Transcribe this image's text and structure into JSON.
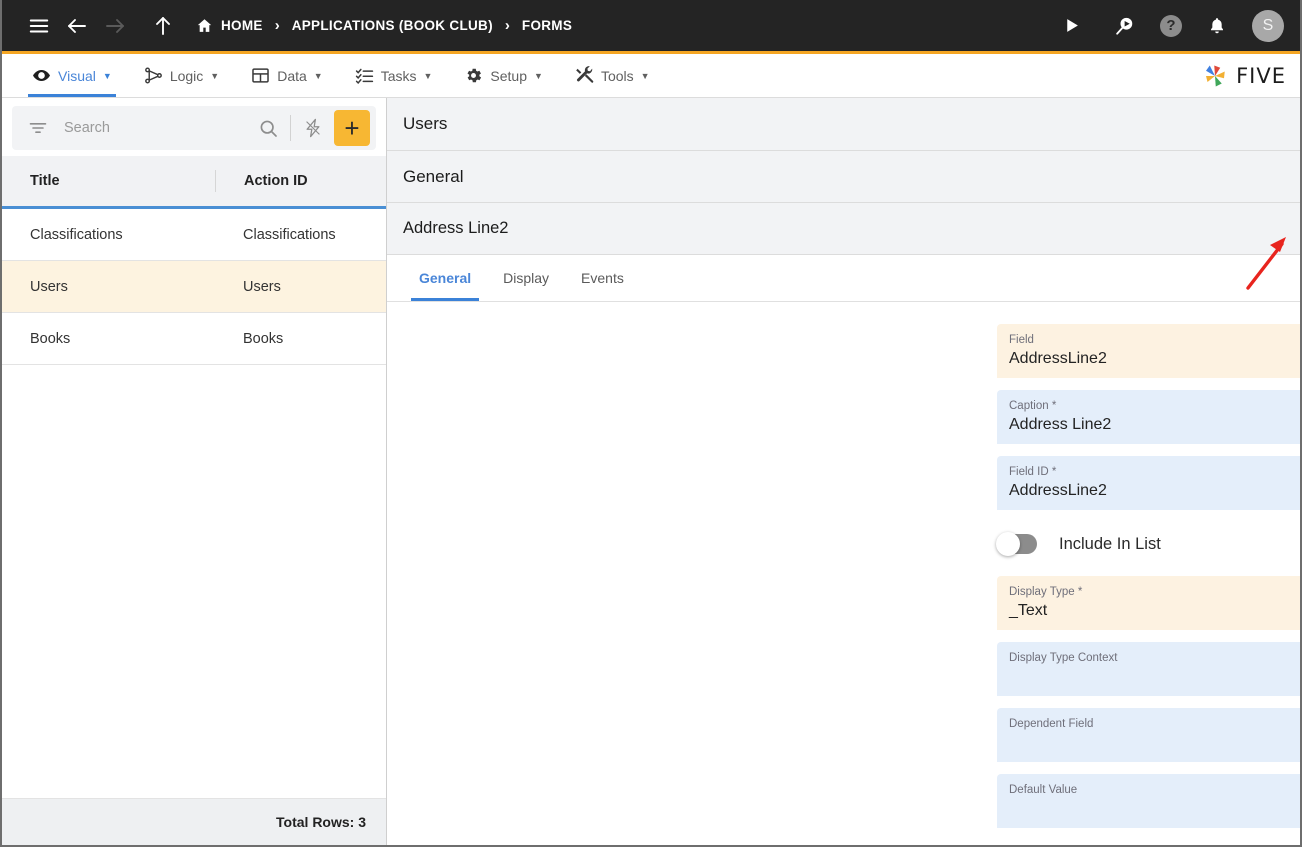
{
  "topbar": {
    "icons": {
      "menu": "hamburger-menu-icon",
      "back": "back-arrow-icon",
      "forward": "forward-arrow-icon",
      "up": "up-arrow-icon"
    },
    "breadcrumbs": [
      {
        "label": "HOME",
        "icon": "home-icon"
      },
      {
        "label": "APPLICATIONS (BOOK CLUB)",
        "icon": ""
      },
      {
        "label": "FORMS",
        "icon": ""
      }
    ],
    "separator": "›",
    "actions": [
      {
        "name": "run-icon",
        "glyph": "▶"
      },
      {
        "name": "search-run-icon",
        "glyph": ""
      },
      {
        "name": "help-icon",
        "glyph": "?"
      },
      {
        "name": "notifications-bell-icon",
        "glyph": ""
      }
    ],
    "avatar_initial": "S",
    "accent_color": "#f5a623"
  },
  "menubar": {
    "items": [
      {
        "label": "Visual",
        "icon": "eye-icon",
        "active": true
      },
      {
        "label": "Logic",
        "icon": "logic-nodes-icon",
        "active": false
      },
      {
        "label": "Data",
        "icon": "table-grid-icon",
        "active": false
      },
      {
        "label": "Tasks",
        "icon": "checklist-icon",
        "active": false
      },
      {
        "label": "Setup",
        "icon": "gear-icon",
        "active": false
      },
      {
        "label": "Tools",
        "icon": "tools-icon",
        "active": false
      }
    ],
    "caret": "▼",
    "brand": "FIVE",
    "active_color": "#4a86d8"
  },
  "left_panel": {
    "search": {
      "placeholder": "Search",
      "value": ""
    },
    "buttons": {
      "filter": "filter-icon",
      "search": "search-icon",
      "lightning": "lightning-bolt-icon",
      "add": "+"
    },
    "table": {
      "columns": [
        "Title",
        "Action ID"
      ],
      "rows": [
        {
          "title": "Classifications",
          "action_id": "Classifications",
          "selected": false
        },
        {
          "title": "Users",
          "action_id": "Users",
          "selected": true
        },
        {
          "title": "Books",
          "action_id": "Books",
          "selected": false
        }
      ]
    },
    "footer": "Total Rows: 3",
    "selected_row_color": "#fdf3e0"
  },
  "right_panel": {
    "header_form": {
      "title": "Users",
      "close": "close-icon",
      "confirm": "check-icon"
    },
    "header_section": {
      "title": "General",
      "back": "back-arrow-icon"
    },
    "header_field": {
      "title": "Address Line2",
      "close": "close-icon",
      "confirm": "check-icon"
    },
    "tabs": [
      {
        "label": "General",
        "active": true
      },
      {
        "label": "Display",
        "active": false
      },
      {
        "label": "Events",
        "active": false
      }
    ],
    "fields": [
      {
        "label": "Field",
        "value": "AddressLine2",
        "style": "yellow",
        "dropdown": true,
        "code": false,
        "help": "help-icon"
      },
      {
        "label": "Caption *",
        "value": "Address Line2",
        "style": "blue",
        "dropdown": false,
        "code": false,
        "help": "help-icon"
      },
      {
        "label": "Field ID *",
        "value": "AddressLine2",
        "style": "blue",
        "dropdown": false,
        "code": false,
        "help": "help-icon"
      }
    ],
    "toggle": {
      "label": "Include In List",
      "on": false,
      "help": "help-icon"
    },
    "fields2": [
      {
        "label": "Display Type *",
        "value": "_Text",
        "style": "yellow",
        "dropdown": true,
        "code": true,
        "help": "help-icon"
      },
      {
        "label": "Display Type Context",
        "value": "",
        "style": "blue",
        "dropdown": false,
        "code": false,
        "help": "help-icon"
      },
      {
        "label": "Dependent Field",
        "value": "",
        "style": "blue",
        "dropdown": true,
        "code": false,
        "help": "help-icon"
      },
      {
        "label": "Default Value",
        "value": "",
        "style": "blue",
        "dropdown": false,
        "code": false,
        "help": "help-icon"
      }
    ],
    "annotation": {
      "name": "red-arrow-annotation",
      "color": "#e8241e",
      "points_to": "check-icon"
    }
  }
}
